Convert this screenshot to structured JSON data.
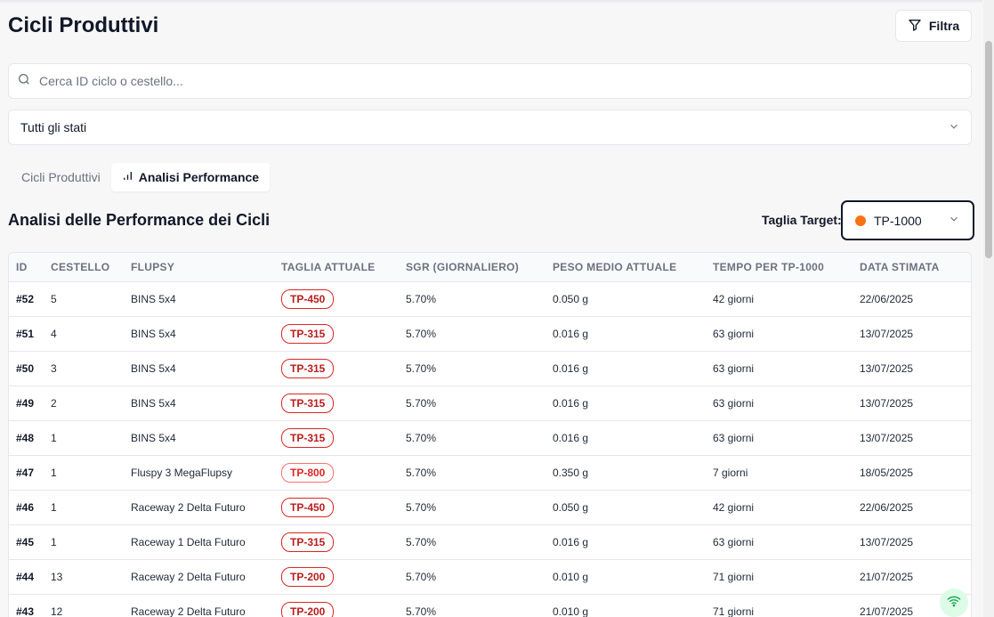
{
  "header": {
    "title": "Cicli Produttivi",
    "filter_label": "Filtra"
  },
  "search": {
    "placeholder": "Cerca ID ciclo o cestello...",
    "value": ""
  },
  "status_filter": {
    "selected": "Tutti gli stati"
  },
  "tabs": [
    {
      "label": "Cicli Produttivi",
      "active": false
    },
    {
      "label": "Analisi Performance",
      "active": true
    }
  ],
  "section": {
    "title": "Analisi delle Performance dei Cicli",
    "target_label": "Taglia Target:",
    "target_value": "TP-1000",
    "target_dot_color": "#f97316"
  },
  "table": {
    "columns": [
      "ID",
      "CESTELLO",
      "FLUPSY",
      "TAGLIA ATTUALE",
      "SGR (GIORNALIERO)",
      "PESO MEDIO ATTUALE",
      "TEMPO PER TP-1000",
      "DATA STIMATA"
    ],
    "rows": [
      {
        "id": "#52",
        "cestello": "5",
        "flupsy": "BINS 5x4",
        "taglia": "TP-450",
        "sgr": "5.70%",
        "peso": "0.050 g",
        "tempo": "42 giorni",
        "data": "22/06/2025"
      },
      {
        "id": "#51",
        "cestello": "4",
        "flupsy": "BINS 5x4",
        "taglia": "TP-315",
        "sgr": "5.70%",
        "peso": "0.016 g",
        "tempo": "63 giorni",
        "data": "13/07/2025"
      },
      {
        "id": "#50",
        "cestello": "3",
        "flupsy": "BINS 5x4",
        "taglia": "TP-315",
        "sgr": "5.70%",
        "peso": "0.016 g",
        "tempo": "63 giorni",
        "data": "13/07/2025"
      },
      {
        "id": "#49",
        "cestello": "2",
        "flupsy": "BINS 5x4",
        "taglia": "TP-315",
        "sgr": "5.70%",
        "peso": "0.016 g",
        "tempo": "63 giorni",
        "data": "13/07/2025"
      },
      {
        "id": "#48",
        "cestello": "1",
        "flupsy": "BINS 5x4",
        "taglia": "TP-315",
        "sgr": "5.70%",
        "peso": "0.016 g",
        "tempo": "63 giorni",
        "data": "13/07/2025"
      },
      {
        "id": "#47",
        "cestello": "1",
        "flupsy": "Fluspy 3 MegaFlupsy",
        "taglia": "TP-800",
        "sgr": "5.70%",
        "peso": "0.350 g",
        "tempo": "7 giorni",
        "data": "18/05/2025"
      },
      {
        "id": "#46",
        "cestello": "1",
        "flupsy": "Raceway 2 Delta Futuro",
        "taglia": "TP-450",
        "sgr": "5.70%",
        "peso": "0.050 g",
        "tempo": "42 giorni",
        "data": "22/06/2025"
      },
      {
        "id": "#45",
        "cestello": "1",
        "flupsy": "Raceway 1 Delta Futuro",
        "taglia": "TP-315",
        "sgr": "5.70%",
        "peso": "0.016 g",
        "tempo": "63 giorni",
        "data": "13/07/2025"
      },
      {
        "id": "#44",
        "cestello": "13",
        "flupsy": "Raceway 2 Delta Futuro",
        "taglia": "TP-200",
        "sgr": "5.70%",
        "peso": "0.010 g",
        "tempo": "71 giorni",
        "data": "21/07/2025"
      },
      {
        "id": "#43",
        "cestello": "12",
        "flupsy": "Raceway 2 Delta Futuro",
        "taglia": "TP-200",
        "sgr": "5.70%",
        "peso": "0.010 g",
        "tempo": "71 giorni",
        "data": "21/07/2025"
      }
    ]
  },
  "icons": {
    "filter": "filter-icon",
    "search": "search-icon",
    "chevron": "chevron-down-icon",
    "chart": "bar-chart-icon",
    "wifi": "wifi-icon"
  },
  "colors": {
    "badge_border": "#dc2626",
    "badge_text": "#b91c1c",
    "target_dot": "#f97316",
    "wifi_bg": "#dcfce7",
    "wifi_icon": "#16a34a"
  }
}
